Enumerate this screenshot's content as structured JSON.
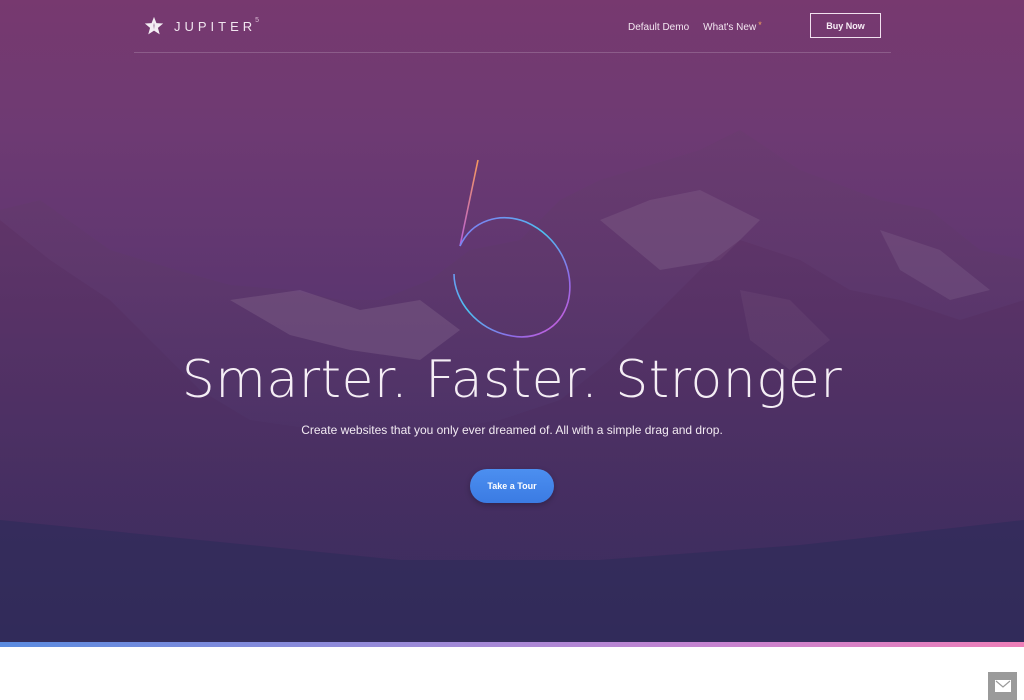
{
  "header": {
    "logo_text": "JUPITER",
    "logo_superscript": "5",
    "logo_icon": "star-icon",
    "nav": [
      {
        "label": "Default Demo"
      },
      {
        "label": "What's New",
        "badge": "*"
      }
    ],
    "buy_label": "Buy Now"
  },
  "hero": {
    "big_numeral": "5",
    "headline": "Smarter. Faster. Stronger",
    "subheadline": "Create websites that you only ever dreamed of. All with a simple drag and drop.",
    "cta_label": "Take a Tour",
    "background": "mountain-landscape-purple-overlay"
  },
  "colors": {
    "overlay_top": "#77396f",
    "overlay_bottom": "#2c2b57",
    "cta": "#3f82e8",
    "accent_star": "#f7a35c",
    "bar_start": "#5a8be0",
    "bar_end": "#ee7fb8"
  },
  "floating": {
    "contact_icon": "envelope-icon"
  }
}
